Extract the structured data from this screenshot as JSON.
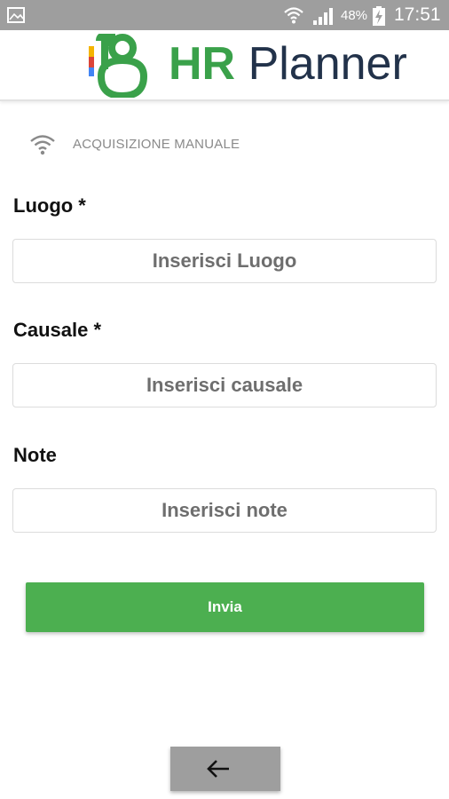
{
  "status_bar": {
    "battery_percent": "48%",
    "time": "17:51",
    "icons": [
      "gallery-icon",
      "wifi-icon",
      "signal-icon",
      "battery-charging-icon"
    ]
  },
  "header": {
    "logo_hr": "HR",
    "logo_planner": "Planner",
    "brand_green": "#3aa14a",
    "brand_dark": "#22324a"
  },
  "mode": {
    "label": "ACQUISIZIONE MANUALE",
    "icon": "wifi-icon"
  },
  "form": {
    "luogo": {
      "label": "Luogo *",
      "placeholder": "Inserisci Luogo",
      "value": ""
    },
    "causale": {
      "label": "Causale *",
      "placeholder": "Inserisci causale",
      "value": ""
    },
    "note": {
      "label": "Note",
      "placeholder": "Inserisci note",
      "value": ""
    }
  },
  "actions": {
    "submit_label": "Invia",
    "submit_color": "#4caf50",
    "back_icon": "arrow-left-icon"
  }
}
